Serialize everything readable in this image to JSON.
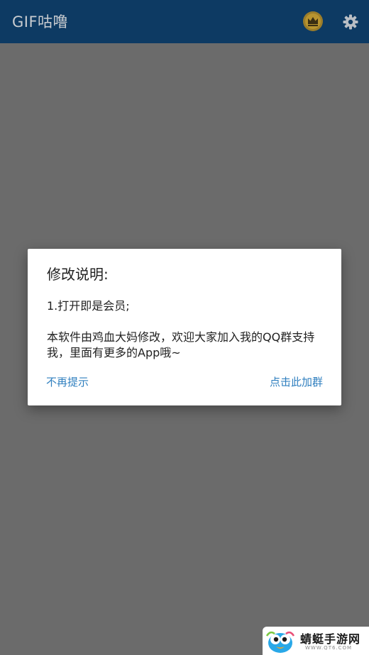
{
  "app": {
    "title": "GIF咕噜"
  },
  "toolbar": {
    "crown_icon": "crown-icon",
    "settings_icon": "gear-icon"
  },
  "dialog": {
    "title": "修改说明:",
    "line1": "1.打开即是会员;",
    "line2": "本软件由鸡血大妈修改，欢迎大家加入我的QQ群支持我，里面有更多的App哦~",
    "negative_label": "不再提示",
    "positive_label": "点击此加群"
  },
  "watermark": {
    "name": "蜻蜓手游网",
    "url": "WWW.QT6.COM"
  },
  "colors": {
    "appbar": "#0d3a63",
    "scrim_background": "#6b6b6b",
    "dialog_button": "#2f7fbf",
    "crown": "#c9a227"
  }
}
